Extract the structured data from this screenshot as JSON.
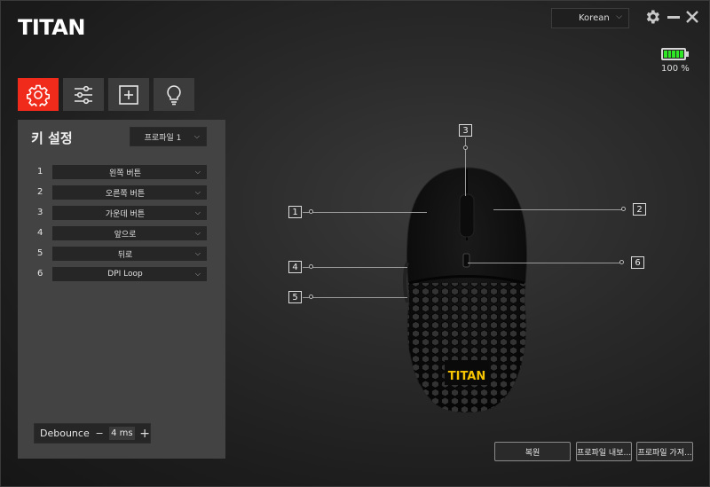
{
  "app": {
    "logo_text": "TITAN"
  },
  "header": {
    "language": "Korean",
    "battery_percent_label": "100 %",
    "battery_level": 1.0,
    "battery_color": "#2ee626"
  },
  "tabs": [
    {
      "icon": "gear-icon",
      "active": true
    },
    {
      "icon": "sliders-icon",
      "active": false
    },
    {
      "icon": "macro-add-icon",
      "active": false
    },
    {
      "icon": "lightbulb-icon",
      "active": false
    }
  ],
  "key_settings": {
    "title": "키 설정",
    "profile": "프로파일 1",
    "rows": [
      {
        "num": "1",
        "value": "왼쪽 버튼"
      },
      {
        "num": "2",
        "value": "오른쪽 버튼"
      },
      {
        "num": "3",
        "value": "가운데 버튼"
      },
      {
        "num": "4",
        "value": "앞으로"
      },
      {
        "num": "5",
        "value": "뒤로"
      },
      {
        "num": "6",
        "value": "DPI Loop"
      }
    ],
    "debounce": {
      "label": "Debounce",
      "minus": "−",
      "value": "4 ms",
      "plus": "+"
    }
  },
  "mouse_markers": [
    "1",
    "2",
    "3",
    "4",
    "5",
    "6"
  ],
  "mouse_logo": "TITAN",
  "footer": {
    "reset": "복원",
    "export": "프로파일 내보...",
    "import": "프로파일 가져..."
  },
  "colors": {
    "accent": "#f02b1c",
    "panel": "#434343",
    "field": "#262626"
  }
}
